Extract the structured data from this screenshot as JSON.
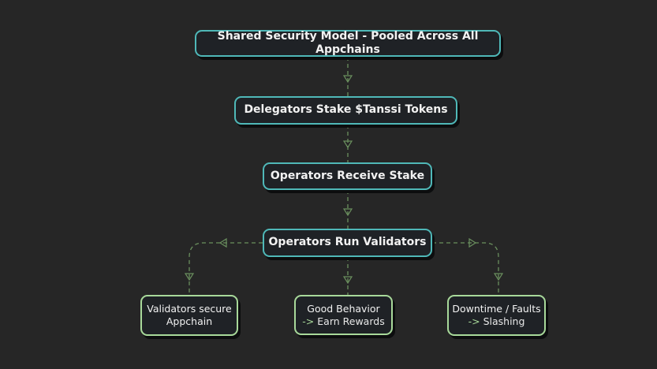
{
  "nodes": {
    "shared_security": "Shared Security Model - Pooled Across All Appchains",
    "delegators_stake": "Delegators Stake $Tanssi Tokens",
    "operators_receive": "Operators Receive Stake",
    "operators_run": "Operators Run Validators",
    "validators_secure": {
      "line1": "Validators secure",
      "line2": "Appchain"
    },
    "good_behavior": {
      "line1": "Good Behavior",
      "arrow": "->",
      "line2": "Earn Rewards"
    },
    "downtime": {
      "line1": "Downtime / Faults",
      "arrow": "->",
      "line2": "Slashing"
    }
  },
  "colors": {
    "background": "#262626",
    "node_fill": "#1f2226",
    "teal_border": "#4fb8b8",
    "green_border": "#a8d99a",
    "connector": "#6a8f5e"
  }
}
